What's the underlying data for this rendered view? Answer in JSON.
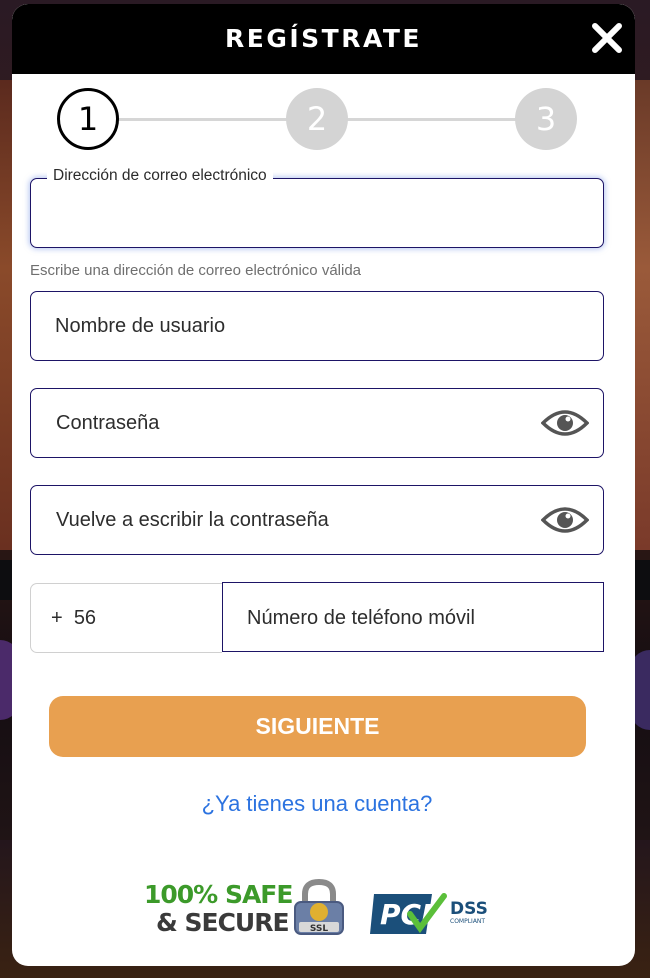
{
  "modal": {
    "title": "REGÍSTRATE",
    "close_icon": "close-icon"
  },
  "stepper": {
    "steps": [
      {
        "label": "1",
        "state": "active"
      },
      {
        "label": "2",
        "state": "inactive"
      },
      {
        "label": "3",
        "state": "inactive"
      }
    ]
  },
  "form": {
    "email": {
      "label": "Dirección de correo electrónico",
      "value": "",
      "hint": "Escribe una dirección de correo electrónico válida"
    },
    "username": {
      "placeholder": "Nombre de usuario"
    },
    "password": {
      "placeholder": "Contraseña",
      "icon": "eye-icon"
    },
    "confirm_password": {
      "placeholder": "Vuelve a escribir la contraseña",
      "icon": "eye-icon"
    },
    "phone": {
      "prefix_plus": "+",
      "prefix_code": "56",
      "placeholder": "Número de teléfono móvil"
    }
  },
  "actions": {
    "next_label": "SIGUIENTE",
    "login_link": "¿Ya tienes una cuenta?"
  },
  "badges": {
    "safe_line1": "100% SAFE",
    "safe_line2": "& SECURE",
    "ssl": "SSL",
    "pci": "PCI",
    "dss": "DSS",
    "dss_sub": "COMPLIANT"
  },
  "colors": {
    "header_bg": "#000000",
    "field_border": "#1d1466",
    "button_bg": "#e8a050",
    "link": "#2c73e0",
    "step_inactive": "#d4d4d4"
  }
}
